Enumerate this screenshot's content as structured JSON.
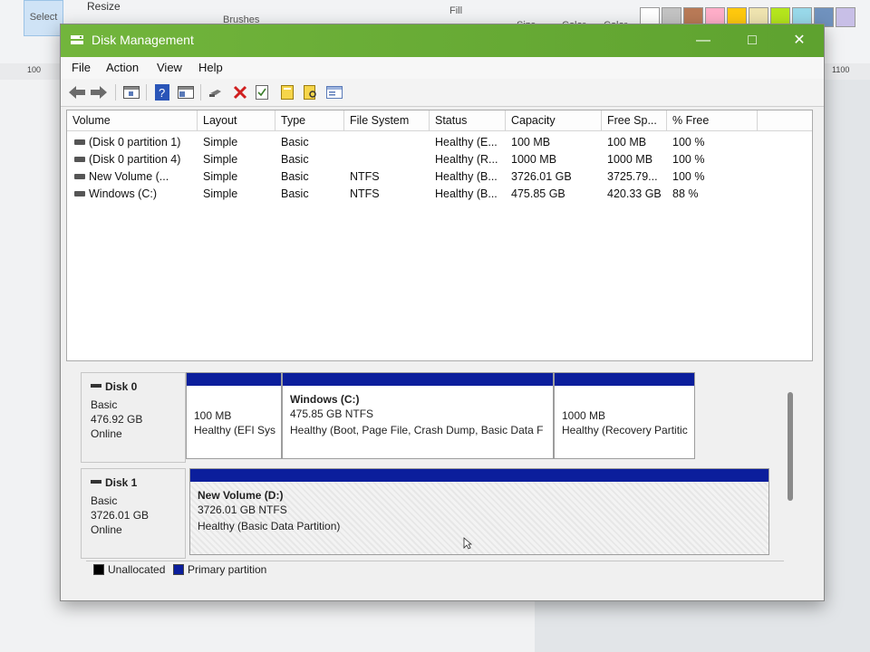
{
  "paint": {
    "select_label": "Select",
    "resize_label": "Resize",
    "brushes_label": "Brushes",
    "fill_label": "Fill",
    "size_label": "Size",
    "color1_label": "Color",
    "color2_label": "Color",
    "ruler_left": "100",
    "ruler_right": "1100",
    "swatches": [
      "#ffffff",
      "#c3c3c3",
      "#b97a57",
      "#ffaec9",
      "#ffc90e",
      "#efe4b0",
      "#b5e61d",
      "#99d9ea",
      "#7092be",
      "#c8bfe7"
    ]
  },
  "window": {
    "title": "Disk Management",
    "accent": "#6aaf37"
  },
  "menu": [
    "File",
    "Action",
    "View",
    "Help"
  ],
  "columns": [
    "Volume",
    "Layout",
    "Type",
    "File System",
    "Status",
    "Capacity",
    "Free Sp...",
    "% Free"
  ],
  "volumes": [
    {
      "volume": "(Disk 0 partition 1)",
      "layout": "Simple",
      "type": "Basic",
      "fs": "",
      "status": "Healthy (E...",
      "capacity": "100 MB",
      "free": "100 MB",
      "pct": "100 %"
    },
    {
      "volume": "(Disk 0 partition 4)",
      "layout": "Simple",
      "type": "Basic",
      "fs": "",
      "status": "Healthy (R...",
      "capacity": "1000 MB",
      "free": "1000 MB",
      "pct": "100 %"
    },
    {
      "volume": "New Volume (...",
      "layout": "Simple",
      "type": "Basic",
      "fs": "NTFS",
      "status": "Healthy (B...",
      "capacity": "3726.01 GB",
      "free": "3725.79...",
      "pct": "100 %"
    },
    {
      "volume": "Windows (C:)",
      "layout": "Simple",
      "type": "Basic",
      "fs": "NTFS",
      "status": "Healthy (B...",
      "capacity": "475.85 GB",
      "free": "420.33 GB",
      "pct": "88 %"
    }
  ],
  "disk0": {
    "name": "Disk 0",
    "kind": "Basic",
    "size": "476.92 GB",
    "state": "Online",
    "partitions": [
      {
        "title": "",
        "line1": "100 MB",
        "line2": "Healthy (EFI Sys"
      },
      {
        "title": "Windows  (C:)",
        "line1": "475.85 GB NTFS",
        "line2": "Healthy (Boot, Page File, Crash Dump, Basic Data F"
      },
      {
        "title": "",
        "line1": "1000 MB",
        "line2": "Healthy (Recovery Partitic"
      }
    ]
  },
  "disk1": {
    "name": "Disk 1",
    "kind": "Basic",
    "size": "3726.01 GB",
    "state": "Online",
    "partition": {
      "title": "New Volume  (D:)",
      "line1": "3726.01 GB NTFS",
      "line2": "Healthy (Basic Data Partition)"
    }
  },
  "legend": {
    "unallocated": "Unallocated",
    "primary": "Primary partition",
    "unallocated_color": "#000000",
    "primary_color": "#0b1e9c"
  }
}
